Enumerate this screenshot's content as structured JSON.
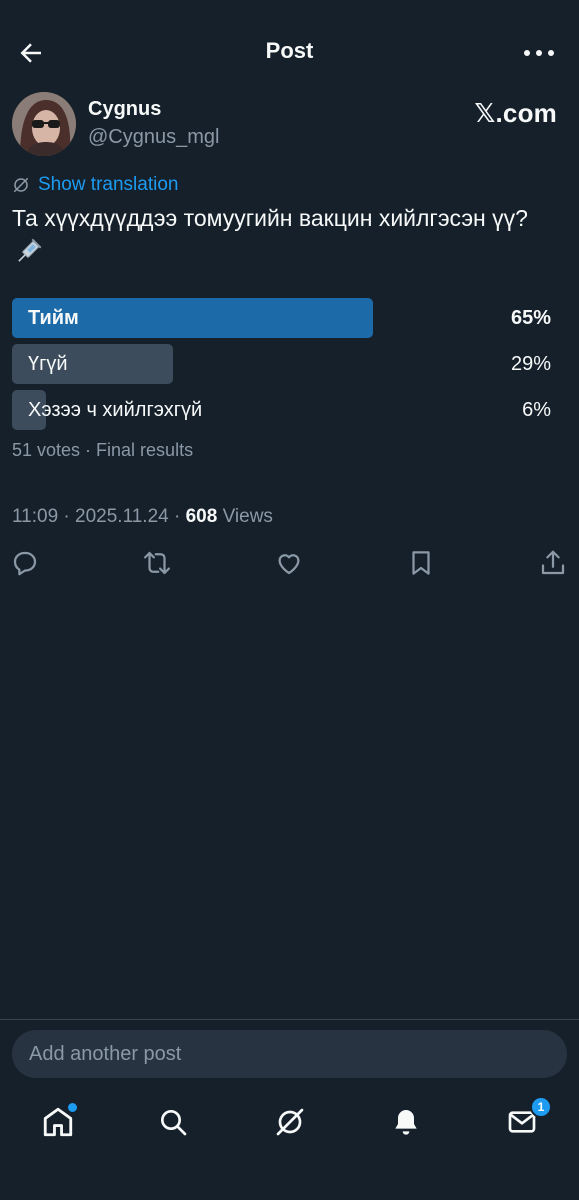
{
  "header": {
    "title": "Post",
    "back_icon": "arrow-left-icon",
    "more_icon": "more-dots-icon"
  },
  "author": {
    "name": "Cygnus",
    "handle": "@Cygnus_mgl",
    "source_label": "𝕏.com"
  },
  "translation": {
    "label": "Show translation",
    "icon": "grok-translate-icon"
  },
  "post": {
    "text": "Та хүүхдүүддээ томуугийн вакцин хийлгэсэн үү?",
    "emoji_icon": "syringe-icon"
  },
  "poll": {
    "options": [
      {
        "label": "Тийм",
        "percent_text": "65%",
        "percent": 65,
        "winner": true
      },
      {
        "label": "Үгүй",
        "percent_text": "29%",
        "percent": 29,
        "winner": false
      },
      {
        "label": "Хэзээ ч хийлгэхгүй",
        "percent_text": "6%",
        "percent": 6,
        "winner": false
      }
    ],
    "meta": "51 votes · Final results"
  },
  "meta": {
    "time": "11:09",
    "date": "2025.11.24",
    "views_count": "608",
    "views_label": "Views",
    "separator": "·"
  },
  "actions": [
    "reply-icon",
    "repost-icon",
    "like-icon",
    "bookmark-icon",
    "share-icon"
  ],
  "compose": {
    "placeholder": "Add another post"
  },
  "nav": {
    "items": [
      "home-icon",
      "search-icon",
      "grok-icon",
      "notifications-icon",
      "messages-icon"
    ],
    "messages_badge": "1"
  },
  "colors": {
    "background": "#15202b",
    "accent": "#1d9bf0",
    "winner_bar": "#1d6aa8",
    "other_bar": "#3c4c5c",
    "muted_text": "#8b98a5"
  }
}
